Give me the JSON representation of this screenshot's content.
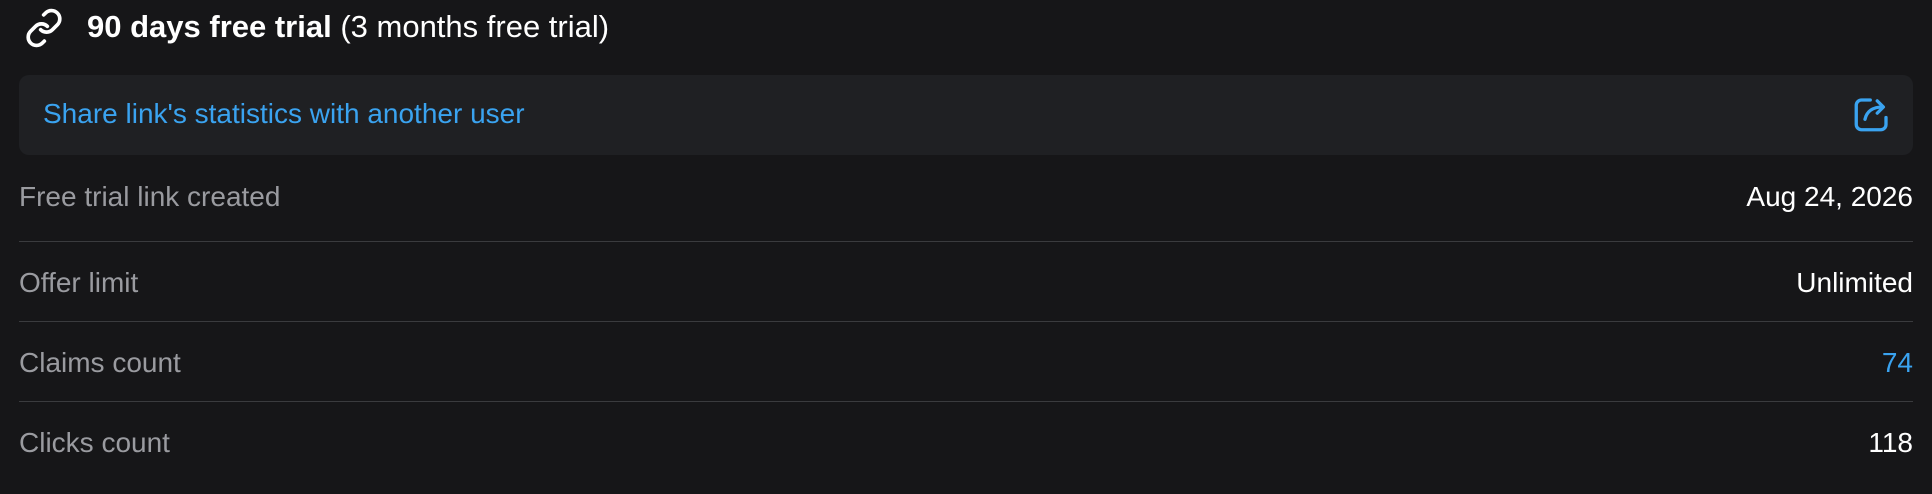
{
  "header": {
    "title_bold": "90 days free trial",
    "title_sub": "(3 months free trial)",
    "icon": "link-icon"
  },
  "share": {
    "label": "Share link's statistics with another user",
    "icon": "share-icon"
  },
  "stats": [
    {
      "label": "Free trial link created",
      "value": "Aug 24, 2026"
    },
    {
      "label": "Offer limit",
      "value": "Unlimited"
    },
    {
      "label": "Claims count",
      "value": "74"
    },
    {
      "label": "Clicks count",
      "value": "118"
    }
  ],
  "colors": {
    "background": "#161618",
    "card": "#1f2023",
    "accent": "#3aa3f0",
    "label": "#9a9ba0",
    "divider": "#3a3b3e"
  }
}
